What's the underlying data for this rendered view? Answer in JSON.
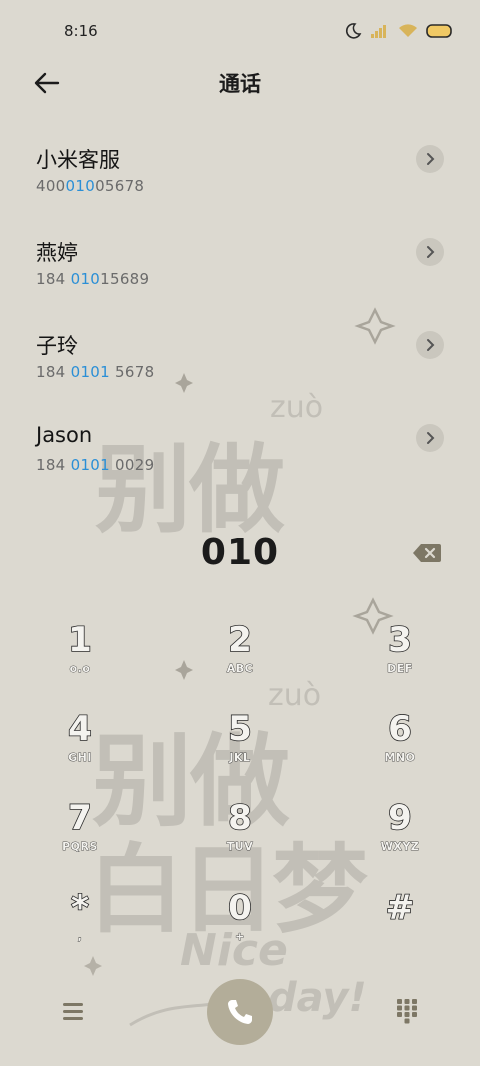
{
  "status_bar": {
    "time": "8:16",
    "icons": [
      "moon-icon",
      "signal-icon",
      "wifi-icon",
      "battery-icon"
    ]
  },
  "header": {
    "title": "通话",
    "back_icon": "back-arrow-icon"
  },
  "contacts": [
    {
      "name": "小米客服",
      "num_pre": "400",
      "num_hl": "010",
      "num_post": "05678"
    },
    {
      "name": "燕婷",
      "num_pre": "184 ",
      "num_hl": "010",
      "num_post": "15689"
    },
    {
      "name": "子玲",
      "num_pre": "184 ",
      "num_hl": "0101",
      "num_post": " 5678"
    },
    {
      "name": "Jason",
      "num_pre": "184 ",
      "num_hl": "0101",
      "num_post": " 0029"
    }
  ],
  "dial_input": {
    "value": "010",
    "delete_icon": "backspace-icon"
  },
  "keypad": [
    {
      "digit": "1",
      "letters": "o.o"
    },
    {
      "digit": "2",
      "letters": "ABC"
    },
    {
      "digit": "3",
      "letters": "DEF"
    },
    {
      "digit": "4",
      "letters": "GHI"
    },
    {
      "digit": "5",
      "letters": "JKL"
    },
    {
      "digit": "6",
      "letters": "MNO"
    },
    {
      "digit": "7",
      "letters": "PQRS"
    },
    {
      "digit": "8",
      "letters": "TUV"
    },
    {
      "digit": "9",
      "letters": "WXYZ"
    },
    {
      "digit": "*",
      "letters": ","
    },
    {
      "digit": "0",
      "letters": "+"
    },
    {
      "digit": "#",
      "letters": ""
    }
  ],
  "bottom_bar": {
    "menu_icon": "menu-icon",
    "call_icon": "phone-icon",
    "keypad_icon": "keypad-grid-icon"
  },
  "wallpaper": {
    "top_text": "别做",
    "top_pinyin": "zuò",
    "bottom_line1": "别做",
    "bottom_line2": "白日梦",
    "bottom_pinyin": "zuò",
    "nice": "Nice",
    "day": "day!"
  },
  "colors": {
    "background": "#dcd9d0",
    "highlight": "#2b8fd6",
    "call_button": "#b3ad99",
    "delete_key": "#7d7765"
  }
}
